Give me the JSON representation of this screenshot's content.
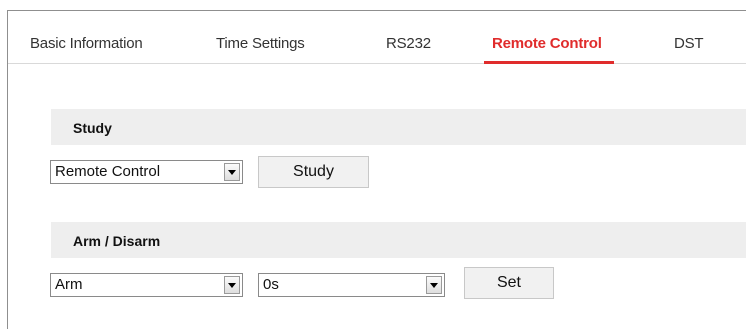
{
  "tabs": [
    {
      "label": "Basic Information",
      "active": false
    },
    {
      "label": "Time Settings",
      "active": false
    },
    {
      "label": "RS232",
      "active": false
    },
    {
      "label": "Remote Control",
      "active": true
    },
    {
      "label": "DST",
      "active": false
    }
  ],
  "study": {
    "header": "Study",
    "select_value": "Remote Control",
    "button_label": "Study"
  },
  "arm_disarm": {
    "header": "Arm / Disarm",
    "mode_value": "Arm",
    "delay_value": "0s",
    "button_label": "Set"
  },
  "colors": {
    "active_tab": "#e02c2c",
    "section_bg": "#eeeeee",
    "button_bg": "#f1f1f1"
  }
}
